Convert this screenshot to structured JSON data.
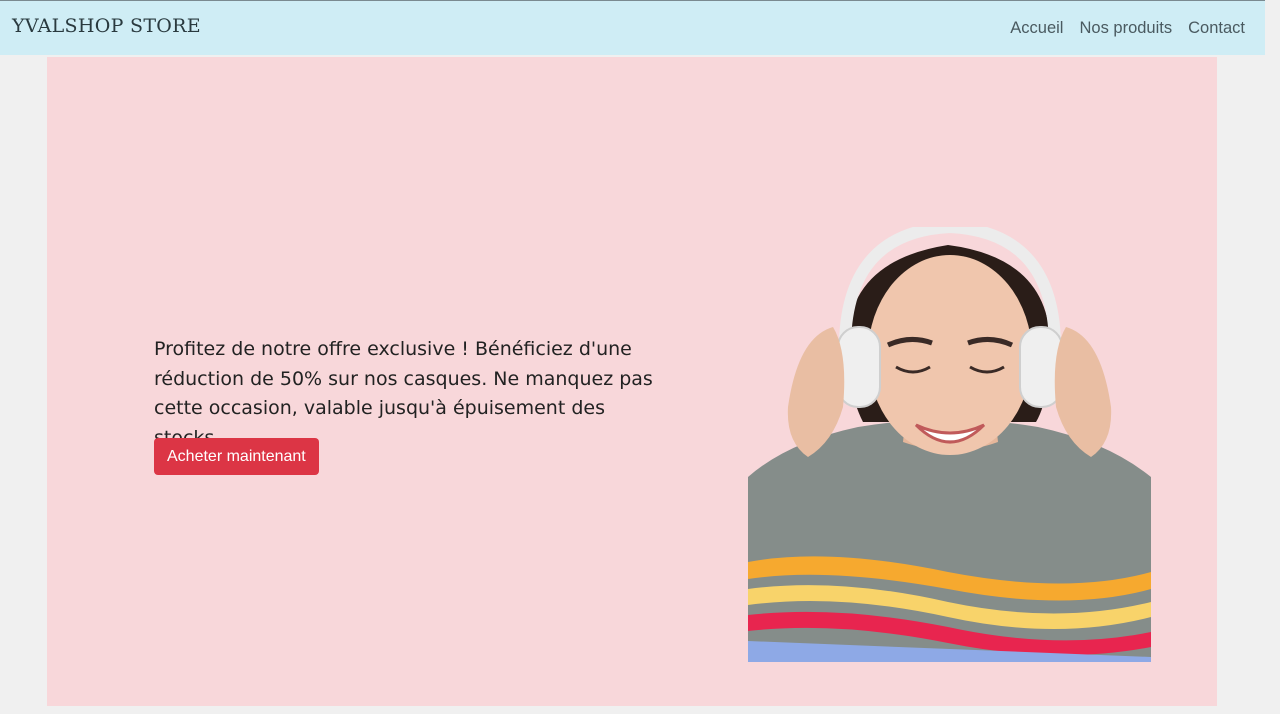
{
  "brand": "YVALSHOP STORE",
  "nav": {
    "items": [
      {
        "label": "Accueil"
      },
      {
        "label": "Nos produits"
      },
      {
        "label": "Contact"
      }
    ]
  },
  "hero": {
    "text": "Profitez de notre offre exclusive ! Bénéficiez d'une réduction de 50% sur nos casques. Ne manquez pas cette occasion, valable jusqu'à épuisement des stocks",
    "button_label": "Acheter maintenant",
    "image_icon": "woman-with-headphones-illustration"
  },
  "colors": {
    "navbar_bg": "#cfedf5",
    "hero_bg": "#f8d7da",
    "button_bg": "#dc3545",
    "page_bg": "#f0f0f0"
  }
}
